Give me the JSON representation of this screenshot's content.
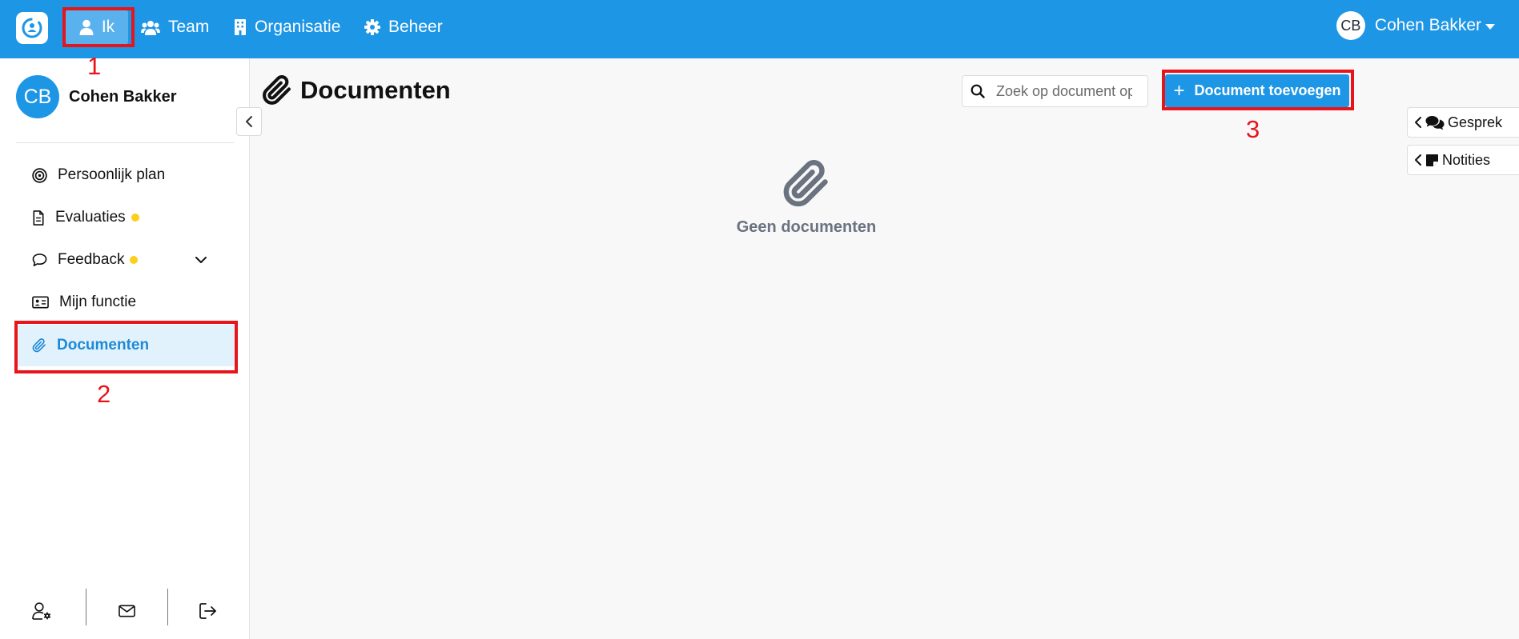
{
  "topbar": {
    "nav": [
      {
        "label": "Ik",
        "icon": "user-icon",
        "active": true
      },
      {
        "label": "Team",
        "icon": "users-icon"
      },
      {
        "label": "Organisatie",
        "icon": "building-icon"
      },
      {
        "label": "Beheer",
        "icon": "gear-icon"
      }
    ],
    "user": {
      "initials": "CB",
      "name": "Cohen Bakker"
    }
  },
  "sidebar": {
    "profile": {
      "initials": "CB",
      "name": "Cohen Bakker"
    },
    "items": [
      {
        "label": "Persoonlijk plan",
        "icon": "target-icon"
      },
      {
        "label": "Evaluaties",
        "icon": "document-icon",
        "badge": "yellow-dot"
      },
      {
        "label": "Feedback",
        "icon": "speech-bubble-icon",
        "badge": "yellow-dot",
        "expandable": true
      },
      {
        "label": "Mijn functie",
        "icon": "id-card-icon"
      },
      {
        "label": "Documenten",
        "icon": "paperclip-icon",
        "active": true
      }
    ],
    "bottom": [
      "user-settings-icon",
      "mail-icon",
      "logout-icon"
    ]
  },
  "main": {
    "title": "Documenten",
    "search": {
      "placeholder": "Zoek op document op naam",
      "value": ""
    },
    "add_button": "Document toevoegen",
    "empty_state": "Geen documenten"
  },
  "side_tabs": [
    {
      "label": "Gesprek",
      "icon": "comments-icon"
    },
    {
      "label": "Notities",
      "icon": "sticky-note-icon"
    }
  ],
  "annotations": [
    "1",
    "2",
    "3"
  ],
  "colors": {
    "primary": "#1e96e6",
    "active_bg": "#e1f2fd",
    "badge": "#fbcf1a",
    "annotation": "#e8141b"
  }
}
